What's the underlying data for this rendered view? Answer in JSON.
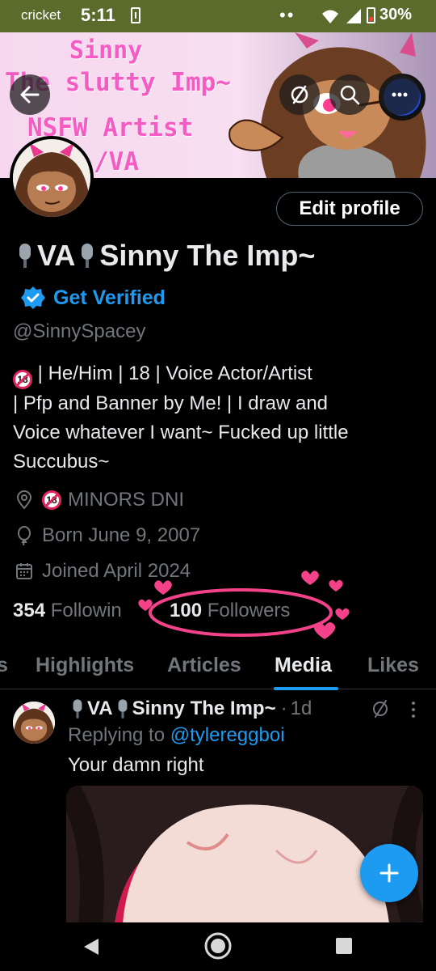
{
  "status_bar": {
    "carrier": "cricket",
    "time": "5:11",
    "notification_dots": "••",
    "battery_percent": "30%"
  },
  "banner": {
    "lines": [
      "Sinny",
      "The slutty Imp~",
      "NSFW Artist",
      "/VA"
    ]
  },
  "profile": {
    "display_name_part1": "VA",
    "display_name_part2": "Sinny The Imp~",
    "get_verified_label": "Get Verified",
    "handle": "@SinnySpacey",
    "edit_profile_label": "Edit profile",
    "bio_line1": " | He/Him | 18 | Voice Actor/Artist",
    "bio_line2": "| Pfp and Banner by Me! | I draw and",
    "bio_line3": "Voice whatever I want~ Fucked up little",
    "bio_line4": "Succubus~",
    "location": "MINORS DNI",
    "birth": "Born June 9, 2007",
    "joined": "Joined April 2024",
    "following_count": "354",
    "following_label": "Followin",
    "followers_count": "100",
    "followers_label": "Followers"
  },
  "tabs": {
    "cut_label": "s",
    "items": [
      "Highlights",
      "Articles",
      "Media",
      "Likes"
    ],
    "active": "Media"
  },
  "post": {
    "author_part1": "VA",
    "author_part2": "Sinny The Imp~",
    "separator": "·",
    "time": "1d",
    "replying_prefix": "Replying to",
    "replying_to": "@tylereggboi",
    "text": "Your damn right"
  },
  "icons": {
    "back": "arrow-left-icon",
    "hide": "eye-slash-icon",
    "search": "search-icon",
    "more": "more-icon",
    "location": "location-pin-icon",
    "birth": "balloon-icon",
    "calendar": "calendar-icon",
    "verified": "verified-badge-icon",
    "compose": "plus-icon"
  },
  "colors": {
    "accent": "#1d9bf0",
    "muted": "#71767b",
    "text": "#e7e9ea",
    "background": "#000000",
    "doodle": "#f4428a"
  }
}
